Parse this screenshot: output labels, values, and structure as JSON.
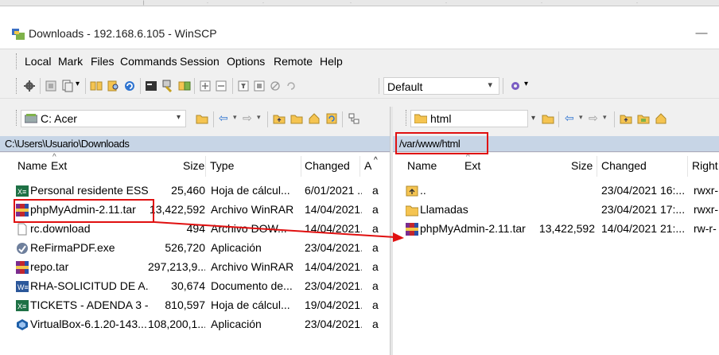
{
  "window": {
    "title": "Downloads - 192.168.6.105 - WinSCP",
    "minimize_glyph": "—"
  },
  "menu": [
    "Local",
    "Mark",
    "Files",
    "Commands",
    "Session",
    "Options",
    "Remote",
    "Help"
  ],
  "toolbar": {
    "transfer_preset": "Default",
    "dropdown_glyph": "▾"
  },
  "left_panel": {
    "drive": "C: Acer",
    "path": "C:\\Users\\Usuario\\Downloads",
    "columns": {
      "name": "Name",
      "ext": "Ext",
      "size": "Size",
      "type": "Type",
      "changed": "Changed",
      "attr": "A"
    },
    "files": [
      {
        "name": "Personal residente ESS...",
        "size": "25,460",
        "type": "Hoja de cálcul...",
        "changed": "6/01/2021 ...",
        "attr": "a",
        "icon": "excel-icon"
      },
      {
        "name": "phpMyAdmin-2.11.tar",
        "size": "13,422,592",
        "type": "Archivo WinRAR",
        "changed": "14/04/2021...",
        "attr": "a",
        "icon": "winrar-icon"
      },
      {
        "name": "rc.download",
        "size": "494",
        "type": "Archivo DOW...",
        "changed": "14/04/2021...",
        "attr": "a",
        "icon": "file-icon"
      },
      {
        "name": "ReFirmaPDF.exe",
        "size": "526,720",
        "type": "Aplicación",
        "changed": "23/04/2021...",
        "attr": "a",
        "icon": "exe-icon"
      },
      {
        "name": "repo.tar",
        "size": "297,213,9...",
        "type": "Archivo WinRAR",
        "changed": "14/04/2021...",
        "attr": "a",
        "icon": "winrar-icon"
      },
      {
        "name": "RHA-SOLICITUD DE A...",
        "size": "30,674",
        "type": "Documento de...",
        "changed": "23/04/2021...",
        "attr": "a",
        "icon": "word-icon"
      },
      {
        "name": "TICKETS - ADENDA 3 -...",
        "size": "810,597",
        "type": "Hoja de cálcul...",
        "changed": "19/04/2021...",
        "attr": "a",
        "icon": "excel-icon"
      },
      {
        "name": "VirtualBox-6.1.20-143...",
        "size": "108,200,1...",
        "type": "Aplicación",
        "changed": "23/04/2021...",
        "attr": "a",
        "icon": "virtualbox-icon"
      }
    ]
  },
  "right_panel": {
    "drive": "html",
    "path": "/var/www/html",
    "columns": {
      "name": "Name",
      "ext": "Ext",
      "size": "Size",
      "changed": "Changed",
      "rights": "Right"
    },
    "files": [
      {
        "name": "..",
        "size": "",
        "changed": "23/04/2021 16:...",
        "rights": "rwxr-",
        "icon": "parent-dir-icon"
      },
      {
        "name": "Llamadas",
        "size": "",
        "changed": "23/04/2021 17:...",
        "rights": "rwxr-",
        "icon": "folder-icon"
      },
      {
        "name": "phpMyAdmin-2.11.tar",
        "size": "13,422,592",
        "changed": "14/04/2021 21:...",
        "rights": "rw-r-",
        "icon": "winrar-icon"
      }
    ]
  },
  "colors": {
    "highlight": "#e01010",
    "path_bar": "#c7d5e6",
    "folder": "#f5c451"
  }
}
